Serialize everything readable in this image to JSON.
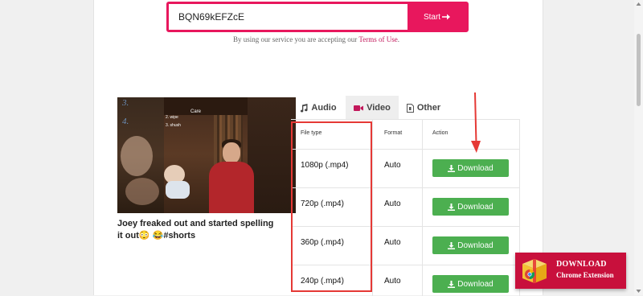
{
  "search": {
    "value": "BQN69kEFZcE",
    "start_label": "Start"
  },
  "terms": {
    "prefix": "By using our service you are accepting our",
    "link": "Terms of Use",
    "suffix": "."
  },
  "video": {
    "thumbnail_overlay": {
      "care": "Care",
      "item1": "2. wipe",
      "item2": "3. shush",
      "num3": "3.",
      "num4": "4."
    },
    "title": "Joey freaked out and started spelling it out😳 😂#shorts"
  },
  "tabs": [
    {
      "label": "Audio",
      "icon": "music-icon"
    },
    {
      "label": "Video",
      "icon": "video-camera-icon"
    },
    {
      "label": "Other",
      "icon": "file-icon"
    }
  ],
  "table": {
    "headers": {
      "type": "File type",
      "format": "Format",
      "action": "Action"
    },
    "rows": [
      {
        "type": "1080p (.mp4)",
        "format": "Auto",
        "action": "Download"
      },
      {
        "type": "720p (.mp4)",
        "format": "Auto",
        "action": "Download"
      },
      {
        "type": "360p (.mp4)",
        "format": "Auto",
        "action": "Download"
      },
      {
        "type": "240p (.mp4)",
        "format": "Auto",
        "action": "Download"
      }
    ]
  },
  "extension": {
    "line1": "DOWNLOAD",
    "line2": "Chrome Extension"
  },
  "colors": {
    "accent": "#e8175d",
    "download_green": "#4caf50",
    "highlight_red": "#e53935",
    "extension_bg": "#c8103c"
  }
}
